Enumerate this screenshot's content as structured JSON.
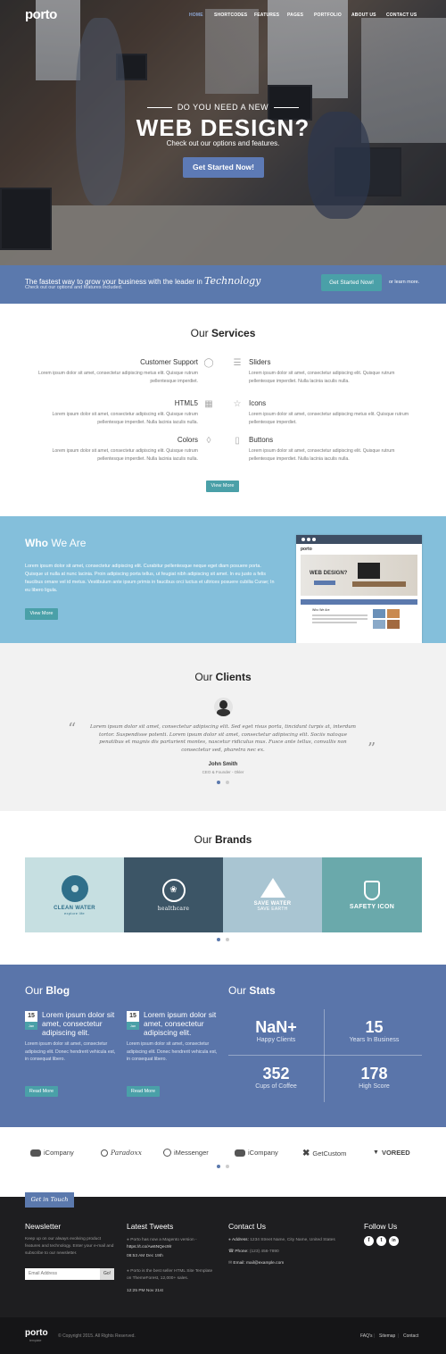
{
  "header": {
    "logo": "porto",
    "nav": [
      "HOME",
      "SHORTCODES",
      "FEATURES",
      "PAGES",
      "PORTFOLIO",
      "ABOUT US",
      "CONTACT US"
    ]
  },
  "hero": {
    "pre_title": "DO YOU NEED A NEW",
    "title": "WEB DESIGN?",
    "subtitle": "Check out our options and features.",
    "button": "Get Started Now!"
  },
  "cta": {
    "text": "The fastest way to grow your business with the leader in",
    "script_word": "Technology",
    "sub": "Check out our options and features included.",
    "button": "Get Started Now!",
    "or_text": "or learn more."
  },
  "services": {
    "title_light": "Our",
    "title_bold": "Services",
    "items": [
      {
        "title": "Customer Support",
        "text": "Lorem ipsum dolor sit amet, consectetur adipiscing metus elit. Quisque rutrum pellentesque imperdiet.",
        "icon": "user-icon"
      },
      {
        "title": "Sliders",
        "text": "Lorem ipsum dolor sit amet, consectetur adipiscing elit. Quisque rutrum pellentesque imperdiet. Nulla lacinia iaculis nulla.",
        "icon": "layers-icon"
      },
      {
        "title": "HTML5",
        "text": "Lorem ipsum dolor sit amet, consectetur adipiscing elit. Quisque rutrum pellentesque imperdiet. Nulla lacinia iaculis nulla.",
        "icon": "grid-icon"
      },
      {
        "title": "Icons",
        "text": "Lorem ipsum dolor sit amet, consectetur adipiscing metus elit. Quisque rutrum pellentesque imperdiet.",
        "icon": "star-icon"
      },
      {
        "title": "Colors",
        "text": "Lorem ipsum dolor sit amet, consectetur adipiscing elit. Quisque rutrum pellentesque imperdiet. Nulla lacinia iaculis nulla.",
        "icon": "drop-icon"
      },
      {
        "title": "Buttons",
        "text": "Lorem ipsum dolor sit amet, consectetur adipiscing elit. Quisque rutrum pellentesque imperdiet. Nulla lacinia iaculis nulla.",
        "icon": "mouse-icon"
      }
    ],
    "button": "View More"
  },
  "who": {
    "title_bold": "Who",
    "title_light": "We Are",
    "text": "Lorem ipsum dolor sit amet, consectetur adipiscing elit. Curabitur pellentesque neque eget diam posuere porta. Quisque ut nulla at nunc lacinia. Proin adipiscing porta tellus, ut feugiat nibh adipiscing sit amet. In eu justo a felis faucibus ornare vel id metus. Vestibulum ante ipsum primis in faucibus orci luctus et ultrices posuere cubilia Curae; In eu libero ligula.",
    "button": "View More",
    "preview": {
      "logo": "porto",
      "headline": "WEB DESIGN?",
      "section": "Who We Are"
    }
  },
  "clients": {
    "title_light": "Our",
    "title_bold": "Clients",
    "quote": "Lorem ipsum dolor sit amet, consectetur adipiscing elit. Sed eget risus porta, tincidunt turpis at, interdum tortor. Suspendisse potenti. Lorem ipsum dolor sit amet, consectetur adipiscing elit. Sociis natoque penatibus et magnis dis parturient montes, nascetur ridiculus mus. Fusce ante tellus, convallis non consectetur sed, pharetra nec ex.",
    "name": "John Smith",
    "role": "CEO & Founder - Okler"
  },
  "brands": {
    "title_light": "Our",
    "title_bold": "Brands",
    "items": [
      {
        "name": "CLEAN WATER",
        "sub": "explore life",
        "bg": "#c6dfe1",
        "fg": "#2f6f8a"
      },
      {
        "name": "healthcare",
        "sub": "",
        "bg": "#3c5566",
        "fg": "#ffffff"
      },
      {
        "name": "SAVE WATER",
        "sub": "SAVE EARTH",
        "bg": "#a9c5d2",
        "fg": "#ffffff"
      },
      {
        "name": "SAFETY ICON",
        "sub": "",
        "bg": "#6aa9ab",
        "fg": "#ffffff"
      }
    ]
  },
  "blog": {
    "title_light": "Our",
    "title_bold": "Blog",
    "posts": [
      {
        "day": "15",
        "month": "Jan",
        "title": "Lorem ipsum dolor sit amet, consectetur adipiscing elit.",
        "text": "Lorem ipsum dolor sit amet, consectetur adipiscing elit. Donec hendrerit vehicula est, in consequat libero.",
        "button": "Read More"
      },
      {
        "day": "15",
        "month": "Jan",
        "title": "Lorem ipsum dolor sit amet, consectetur adipiscing elit.",
        "text": "Lorem ipsum dolor sit amet, consectetur adipiscing elit. Donec hendrerit vehicula est, in consequat libero.",
        "button": "Read More"
      }
    ]
  },
  "stats": {
    "title_light": "Our",
    "title_bold": "Stats",
    "items": [
      {
        "value": "NaN+",
        "label": "Happy Clients"
      },
      {
        "value": "15",
        "label": "Years In Business"
      },
      {
        "value": "352",
        "label": "Cups of Coffee"
      },
      {
        "value": "178",
        "label": "High Score"
      }
    ]
  },
  "partners": [
    "iCompany",
    "Paradoxx",
    "iMessenger",
    "iCompany",
    "GetCustom",
    "VOREED"
  ],
  "footer": {
    "tag": "Get in Touch",
    "newsletter": {
      "title": "Newsletter",
      "text": "Keep up on our always evolving product features and technology. Enter your e-mail and subscribe to our newsletter.",
      "placeholder": "Email Address",
      "button": "Go!"
    },
    "tweets": {
      "title": "Latest Tweets",
      "items": [
        {
          "text": "Porto has now a Magento version -",
          "link": "https://t.co/Aw6NQec9lr",
          "time": "08:53 AM Dec 19th"
        },
        {
          "text": "Porto is the best seller HTML Site Template on ThemeForest, 12,000+ sales.",
          "link": "",
          "time": "12:25 PM Nov 21st"
        }
      ]
    },
    "contact": {
      "title": "Contact Us",
      "address_label": "Address:",
      "address": "1234 Street Name, City Name, United States",
      "phone_label": "Phone:",
      "phone": "(123) 456-7890",
      "email_label": "Email:",
      "email": "mail@example.com"
    },
    "follow": {
      "title": "Follow Us",
      "icons": [
        "f",
        "t",
        "in"
      ]
    }
  },
  "bottom": {
    "logo": "porto",
    "logo_sub": "template",
    "copyright": "© Copyright 2015. All Rights Reserved.",
    "links": [
      "FAQ's",
      "Sitemap",
      "Contact"
    ]
  }
}
